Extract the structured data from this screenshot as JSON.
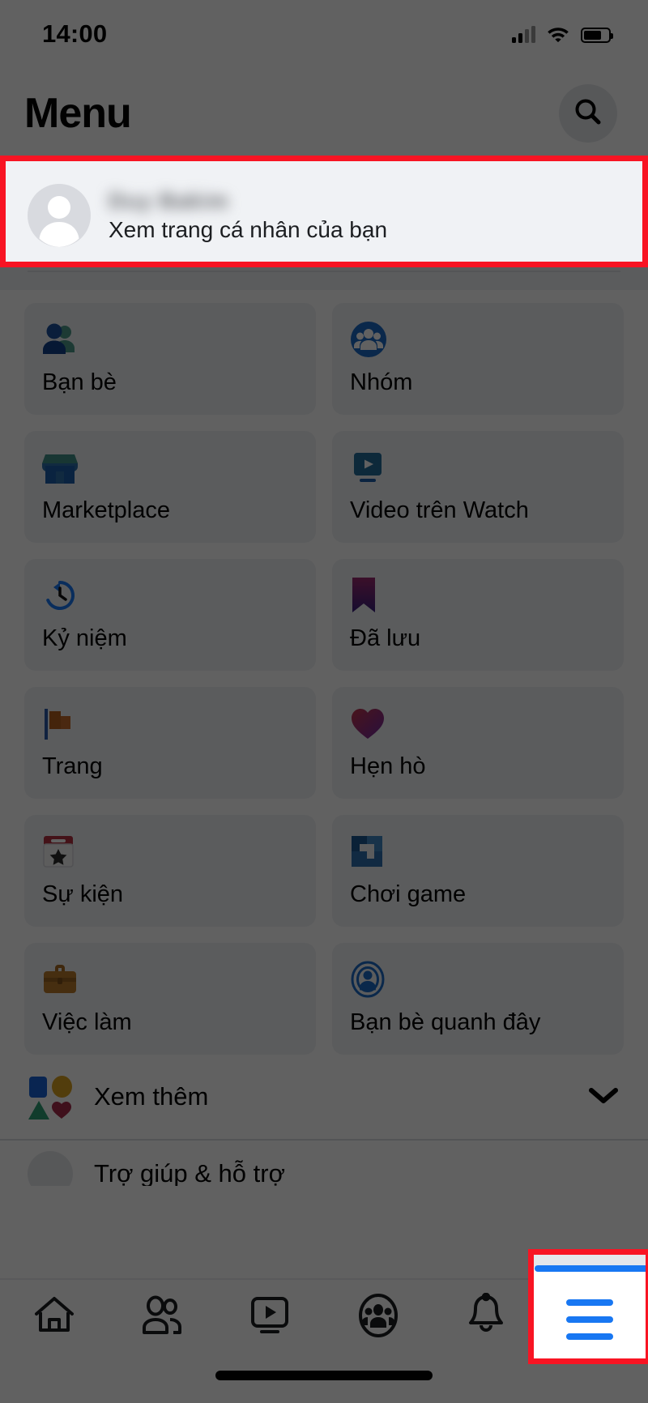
{
  "status_bar": {
    "time": "14:00",
    "signal_icon": "cellular-signal-icon",
    "wifi_icon": "wifi-icon",
    "battery_icon": "battery-icon",
    "battery_level": 72
  },
  "header": {
    "title": "Menu",
    "search_icon": "search-icon"
  },
  "profile": {
    "name": "",
    "subtitle": "Xem trang cá nhân của bạn",
    "avatar_icon": "default-avatar-icon",
    "highlighted": true
  },
  "menu_grid": [
    {
      "label": "Bạn bè",
      "icon": "friends-icon"
    },
    {
      "label": "Nhóm",
      "icon": "groups-icon"
    },
    {
      "label": "Marketplace",
      "icon": "marketplace-icon"
    },
    {
      "label": "Video trên Watch",
      "icon": "watch-video-icon"
    },
    {
      "label": "Kỷ niệm",
      "icon": "memories-clock-icon"
    },
    {
      "label": "Đã lưu",
      "icon": "saved-bookmark-icon"
    },
    {
      "label": "Trang",
      "icon": "pages-flag-icon"
    },
    {
      "label": "Hẹn hò",
      "icon": "dating-heart-icon"
    },
    {
      "label": "Sự kiện",
      "icon": "events-calendar-icon"
    },
    {
      "label": "Chơi game",
      "icon": "gaming-icon"
    },
    {
      "label": "Việc làm",
      "icon": "jobs-briefcase-icon"
    },
    {
      "label": "Bạn bè quanh đây",
      "icon": "nearby-friends-icon"
    }
  ],
  "see_more": {
    "label": "Xem thêm",
    "icon": "four-shapes-icon",
    "chevron_icon": "chevron-down-icon"
  },
  "cut_off_row": {
    "label": "Trợ giúp & hỗ trợ",
    "icon": "help-support-icon"
  },
  "bottom_nav": [
    {
      "label": "Trang chủ",
      "icon": "home-icon",
      "active": false
    },
    {
      "label": "Bạn bè",
      "icon": "friends-icon",
      "active": false
    },
    {
      "label": "Watch",
      "icon": "watch-icon",
      "active": false
    },
    {
      "label": "Nhóm",
      "icon": "groups-icon",
      "active": false
    },
    {
      "label": "Thông báo",
      "icon": "bell-icon",
      "active": false
    },
    {
      "label": "Menu",
      "icon": "hamburger-menu-icon",
      "active": true
    }
  ],
  "annotations": {
    "highlight_color": "#f81423",
    "highlight_regions": [
      "profile-row",
      "hamburger-menu-button"
    ],
    "dim_overlay": "rgba(0,0,0,0.62)"
  },
  "colors": {
    "accent": "#1877f2",
    "tile_bg": "#f0f2f5",
    "text_primary": "#050505",
    "page_bg": "#ffffff"
  }
}
